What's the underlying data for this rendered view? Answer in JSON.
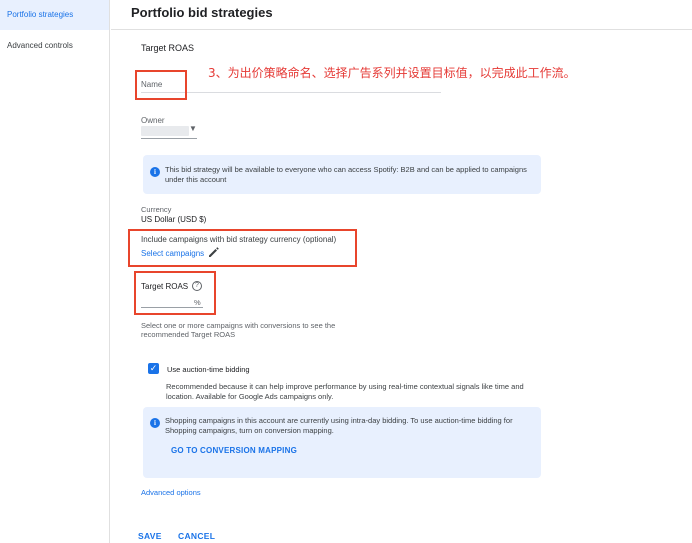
{
  "sidebar": {
    "items": [
      {
        "label": "Portfolio strategies",
        "active": true
      },
      {
        "label": "Advanced controls",
        "active": false
      }
    ]
  },
  "header": {
    "title": "Portfolio bid strategies"
  },
  "form": {
    "section_title": "Target ROAS",
    "annotation": "3、为出价策略命名、选择广告系列并设置目标值，以完成此工作流。",
    "name_label": "Name",
    "owner_label": "Owner",
    "info_text_1": "This bid strategy will be available to everyone who can access Spotify: B2B and can be applied to campaigns under this account",
    "currency_label": "Currency",
    "currency_value": "US Dollar (USD $)",
    "include_label": "Include campaigns with bid strategy currency (optional)",
    "select_campaigns": "Select campaigns",
    "target_roas_label": "Target ROAS",
    "percent_suffix": "%",
    "roas_help": "Select one or more campaigns with conversions to see the recommended Target ROAS",
    "auction_label": "Use auction-time bidding",
    "auction_checked": true,
    "auction_desc": "Recommended because it can help improve performance by using real-time contextual signals like time and location. Available for Google Ads campaigns only.",
    "info_text_2": "Shopping campaigns in this account are currently using intra-day bidding. To use auction-time bidding for Shopping campaigns, turn on conversion mapping.",
    "conversion_link": "GO TO CONVERSION MAPPING",
    "advanced_options": "Advanced options"
  },
  "actions": {
    "save": "SAVE",
    "cancel": "CANCEL"
  },
  "icons": {
    "info": "info-icon",
    "help": "help-icon",
    "pencil": "pencil-icon",
    "check": "checkbox-check-icon",
    "dropdown": "dropdown-caret-icon"
  },
  "colors": {
    "accent": "#1a73e8",
    "highlight": "#e8452c",
    "info_bg": "#e8f0fe",
    "annotation": "#e53935"
  }
}
